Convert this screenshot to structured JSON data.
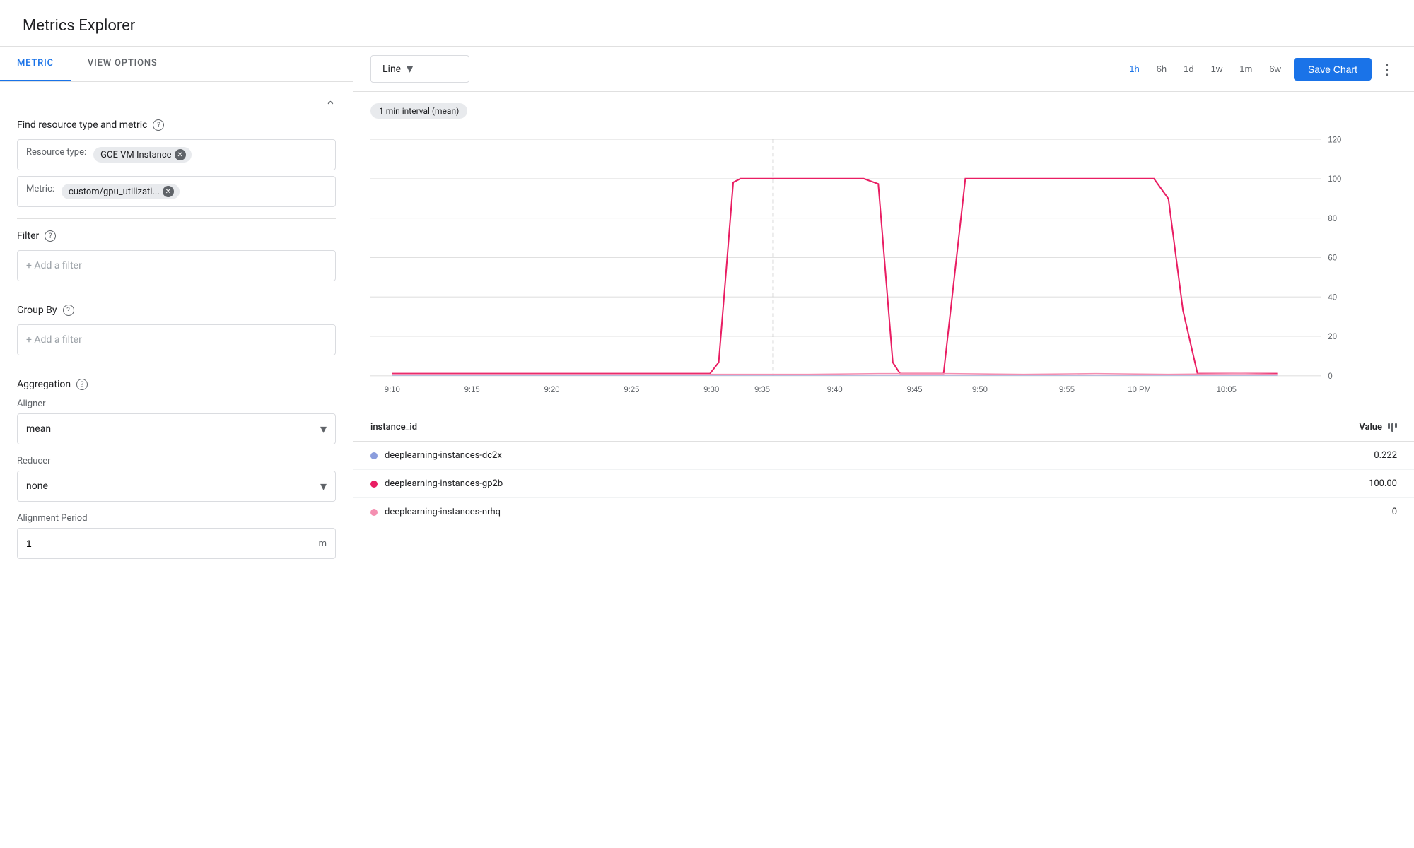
{
  "page": {
    "title": "Metrics Explorer"
  },
  "tabs": [
    {
      "id": "metric",
      "label": "METRIC",
      "active": true
    },
    {
      "id": "view-options",
      "label": "VIEW OPTIONS",
      "active": false
    }
  ],
  "left_panel": {
    "find_resource_label": "Find resource type and metric",
    "resource_type_label": "Resource type:",
    "resource_type_value": "GCE VM Instance",
    "metric_label": "Metric:",
    "metric_value": "custom/gpu_utilizati...",
    "filter_label": "Filter",
    "filter_placeholder": "+ Add a filter",
    "group_by_label": "Group By",
    "group_by_placeholder": "+ Add a filter",
    "aggregation_label": "Aggregation",
    "aligner_label": "Aligner",
    "aligner_value": "mean",
    "reducer_label": "Reducer",
    "reducer_value": "none",
    "alignment_period_label": "Alignment Period",
    "alignment_period_value": "1",
    "alignment_period_unit": "m"
  },
  "chart_toolbar": {
    "chart_type_label": "Line",
    "time_ranges": [
      {
        "label": "1h",
        "active": true
      },
      {
        "label": "6h",
        "active": false
      },
      {
        "label": "1d",
        "active": false
      },
      {
        "label": "1w",
        "active": false
      },
      {
        "label": "1m",
        "active": false
      },
      {
        "label": "6w",
        "active": false
      }
    ],
    "save_btn_label": "Save Chart",
    "interval_badge": "1 min interval (mean)"
  },
  "chart": {
    "y_labels": [
      "120",
      "100",
      "80",
      "60",
      "40",
      "20",
      "0"
    ],
    "x_labels": [
      "9:10",
      "9:15",
      "9:20",
      "9:25",
      "9:30",
      "9:35",
      "9:40",
      "9:45",
      "9:50",
      "9:55",
      "10 PM",
      "10:05"
    ],
    "series": [
      {
        "name": "deeplearning-instances-dc2x",
        "color": "#8b9ddd",
        "type": "flat_low"
      },
      {
        "name": "deeplearning-instances-gp2b",
        "color": "#e91e63",
        "type": "two_peaks"
      },
      {
        "name": "deeplearning-instances-nrhq",
        "color": "#f48fb1",
        "type": "partial"
      }
    ]
  },
  "data_table": {
    "instance_col": "instance_id",
    "value_col": "Value",
    "rows": [
      {
        "name": "deeplearning-instances-dc2x",
        "color": "#8b9ddd",
        "value": "0.222"
      },
      {
        "name": "deeplearning-instances-gp2b",
        "color": "#e91e63",
        "value": "100.00"
      },
      {
        "name": "deeplearning-instances-nrhq",
        "color": "#f48fb1",
        "value": "0"
      }
    ]
  }
}
